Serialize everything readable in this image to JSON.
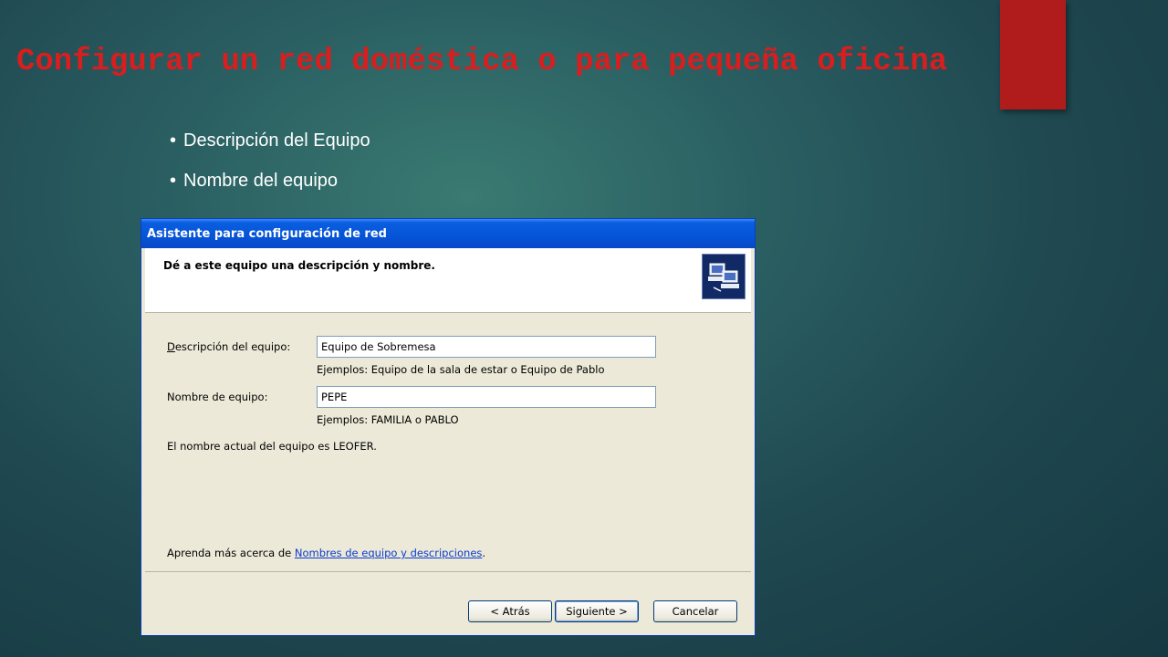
{
  "slide": {
    "title": "Configurar un red doméstica o para pequeña oficina",
    "bullets": [
      "Descripción del Equipo",
      "Nombre del equipo"
    ]
  },
  "dialog": {
    "title": "Asistente para configuración de red",
    "header_text": "Dé a este equipo una descripción y nombre.",
    "description_label": "Descripción del equipo:",
    "description_value": "Equipo de Sobremesa",
    "description_hint": "Ejemplos: Equipo de la sala de estar o Equipo de Pablo",
    "name_label": "Nombre de equipo:",
    "name_value": "PEPE",
    "name_hint": "Ejemplos: FAMILIA o PABLO",
    "current_name_text": "El nombre actual del equipo es LEOFER.",
    "learn_more_prefix": "Aprenda más acerca de ",
    "learn_more_link": "Nombres de equipo y descripciones",
    "learn_more_suffix": ".",
    "buttons": {
      "back": "< Atrás",
      "next": "Siguiente >",
      "cancel": "Cancelar"
    }
  },
  "icons": {
    "wizard": "network-computers-icon"
  },
  "colors": {
    "title_red": "#d81e1e",
    "accent_tab": "#b01c1c",
    "xp_titlebar": "#0554d8"
  }
}
